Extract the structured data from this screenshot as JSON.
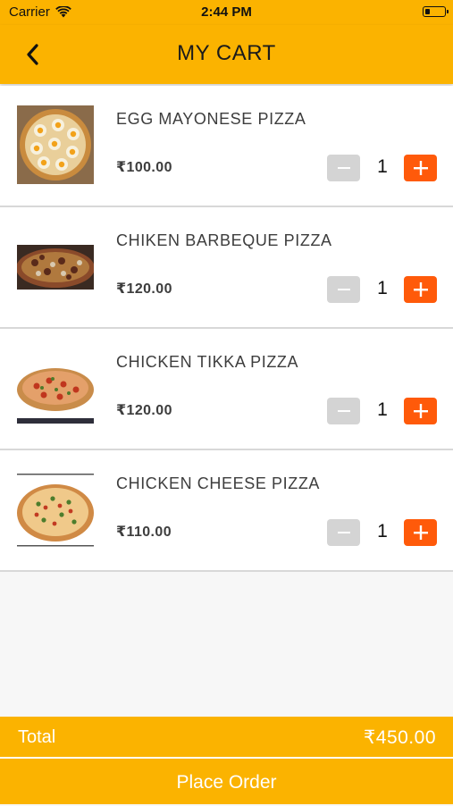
{
  "status_bar": {
    "carrier": "Carrier",
    "time": "2:44 PM",
    "battery_level": 0.25
  },
  "header": {
    "title": "MY CART",
    "back_icon": "chevron-left-icon"
  },
  "cart": {
    "items": [
      {
        "name": "EGG MAYONESE PIZZA",
        "price": "₹100.00",
        "qty": "1",
        "image": "egg-mayonese-pizza-photo"
      },
      {
        "name": "CHIKEN BARBEQUE PIZZA",
        "price": "₹120.00",
        "qty": "1",
        "image": "chiken-barbeque-pizza-photo"
      },
      {
        "name": "CHICKEN TIKKA PIZZA",
        "price": "₹120.00",
        "qty": "1",
        "image": "chicken-tikka-pizza-photo"
      },
      {
        "name": "CHICKEN CHEESE PIZZA",
        "price": "₹110.00",
        "qty": "1",
        "image": "chicken-cheese-pizza-photo"
      }
    ]
  },
  "footer": {
    "total_label": "Total",
    "total_value": "₹450.00",
    "place_order_label": "Place Order"
  },
  "colors": {
    "accent": "#fbb300",
    "plus_button": "#ff5a0a",
    "minus_button": "#d4d4d4"
  }
}
